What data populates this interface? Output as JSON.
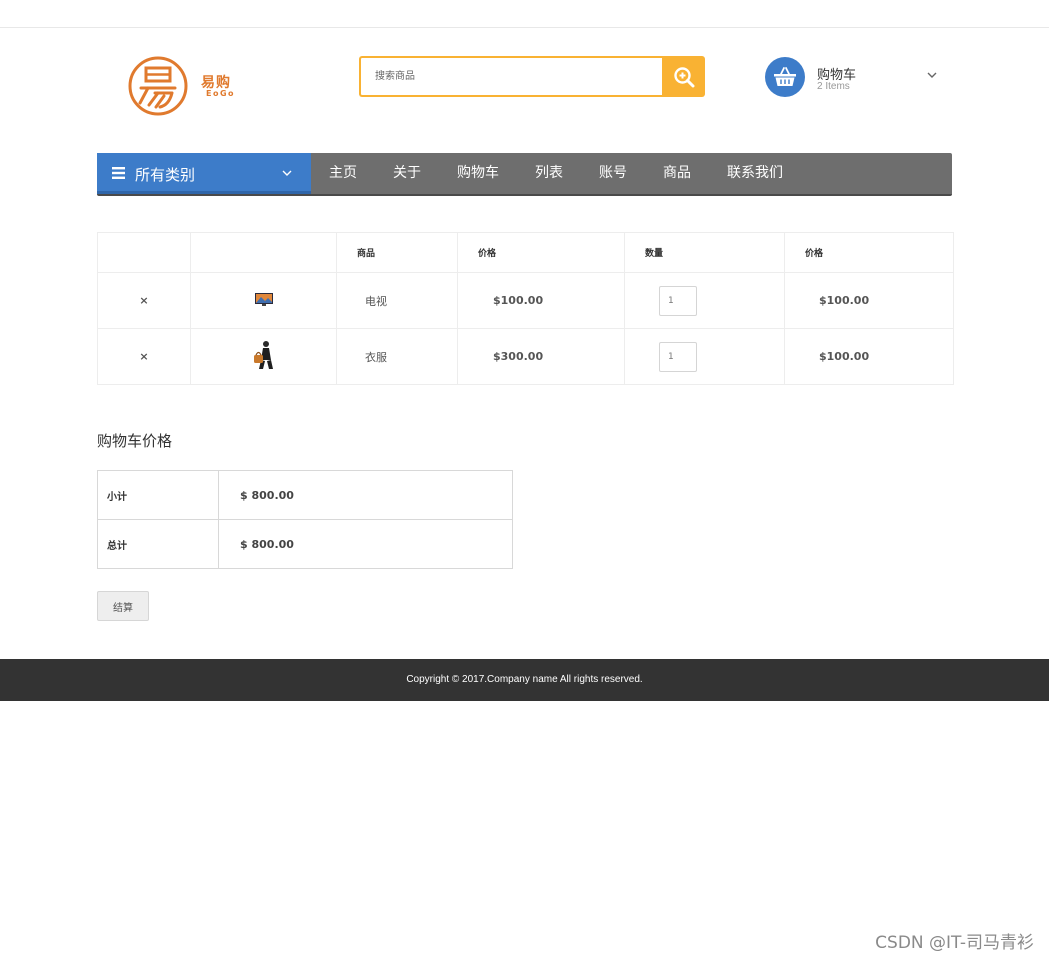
{
  "brand": {
    "name": "易购",
    "sub": "EoGo",
    "color": "#e07a2e"
  },
  "search": {
    "placeholder": "搜索商品",
    "icon": "search-plus-icon",
    "accent": "#f9b233"
  },
  "mini_cart": {
    "title": "购物车",
    "count": "2 Items",
    "icon": "basket-icon",
    "accent": "#3d7cc9"
  },
  "nav": {
    "categories_label": "所有类别",
    "items": [
      "主页",
      "关于",
      "购物车",
      "列表",
      "账号",
      "商品",
      "联系我们"
    ]
  },
  "cart_table": {
    "headers": [
      "",
      "",
      "商品",
      "价格",
      "数量",
      "价格"
    ],
    "rows": [
      {
        "remove": "×",
        "image": "tv-thumbnail",
        "name": "电视",
        "price": "$100.00",
        "qty": "1",
        "total": "$100.00"
      },
      {
        "remove": "×",
        "image": "clothes-thumbnail",
        "name": "衣服",
        "price": "$300.00",
        "qty": "1",
        "total": "$100.00"
      }
    ]
  },
  "totals": {
    "heading": "购物车价格",
    "subtotal_label": "小计",
    "subtotal_value": "$ 800.00",
    "total_label": "总计",
    "total_value": "$ 800.00"
  },
  "checkout_label": "结算",
  "footer": {
    "copyright": "Copyright © 2017.Company name All rights reserved."
  },
  "watermark": "CSDN @IT-司马青衫"
}
